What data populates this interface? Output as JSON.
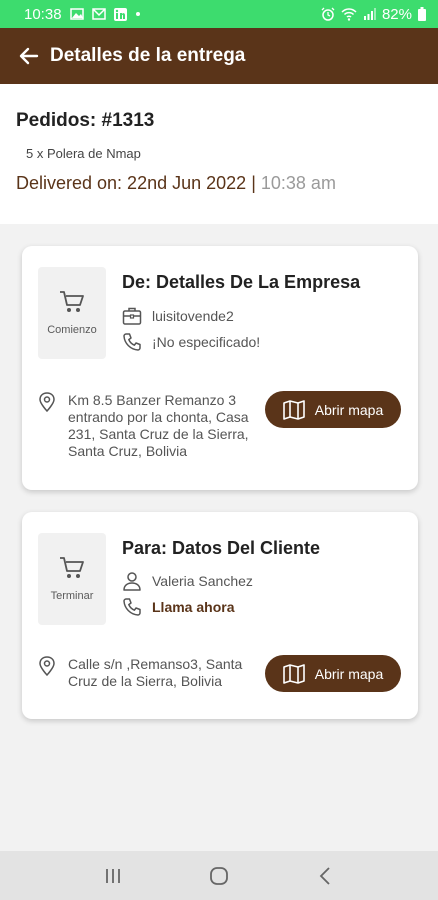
{
  "status_bar": {
    "time": "10:38",
    "battery": "82%",
    "icons": [
      "photo-icon",
      "gmail-icon",
      "linkedin-icon",
      "dot-icon",
      "alarm-icon",
      "wifi-icon",
      "signal-icon",
      "battery-icon"
    ]
  },
  "app_bar": {
    "title": "Detalles de la entrega",
    "back_icon": "arrow-left-icon"
  },
  "order": {
    "title": "Pedidos: #1313",
    "item": "5 x Polera de Nmap",
    "delivered_on": "Delivered on: 22nd Jun 2022",
    "separator": "|",
    "time": "10:38 am"
  },
  "pickup_card": {
    "cart_label": "Comienzo",
    "title": "De: Detalles De La Empresa",
    "business": "luisitovende2",
    "phone": "¡No especificado!",
    "address": "Km 8.5 Banzer Remanzo 3 entrando por la chonta, Casa 231, Santa Cruz de la Sierra, Santa Cruz, Bolivia",
    "map_button": "Abrir mapa"
  },
  "dropoff_card": {
    "cart_label": "Terminar",
    "title": "Para: Datos Del Cliente",
    "customer": "Valeria Sanchez",
    "call": "Llama ahora",
    "address": "Calle s/n ,Remanso3, Santa Cruz de la Sierra, Bolivia",
    "map_button": "Abrir mapa"
  },
  "colors": {
    "status_bar": "#3ddc6e",
    "brand_brown": "#5a3419",
    "background": "#f2f2f2",
    "nav_bar": "#e3e3e3"
  },
  "nav_bar": {
    "icons": [
      "recents-icon",
      "home-icon",
      "back-icon"
    ]
  }
}
